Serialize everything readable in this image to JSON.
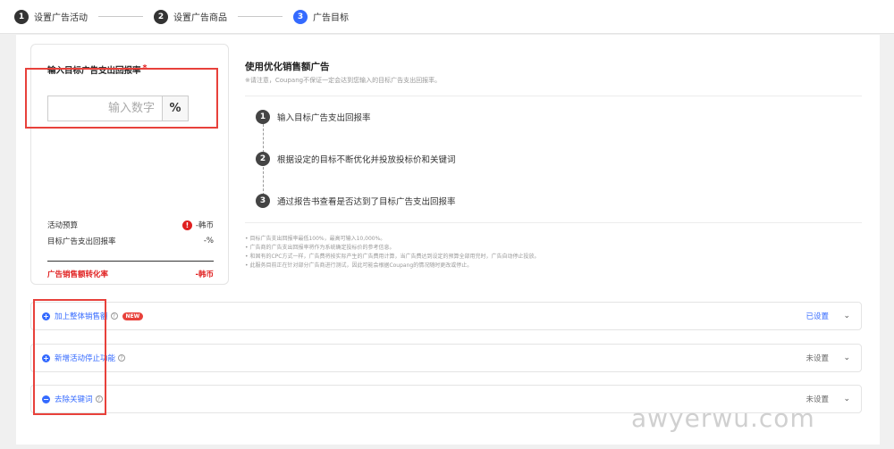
{
  "stepper": {
    "steps": [
      {
        "num": "1",
        "label": "设置广告活动"
      },
      {
        "num": "2",
        "label": "设置广告商品"
      },
      {
        "num": "3",
        "label": "广告目标"
      }
    ]
  },
  "target": {
    "title": "输入目标广告支出回报率",
    "required_mark": "*",
    "placeholder": "输入数字",
    "unit": "%"
  },
  "summary": {
    "budget_label": "活动预算",
    "budget_value": "-韩币",
    "roas_label": "目标广告支出回报率",
    "roas_value": "-%",
    "conversion_label": "广告销售额转化率",
    "conversion_value": "-韩币",
    "alert_glyph": "!"
  },
  "info": {
    "title": "使用优化销售额广告",
    "note": "※请注意，Coupang不保证一定会达到您输入的目标广告支出回报率。",
    "steps": [
      {
        "num": "1",
        "text": "输入目标广告支出回报率"
      },
      {
        "num": "2",
        "text": "根据设定的目标不断优化并投放投标价和关键词"
      },
      {
        "num": "3",
        "text": "通过报告书查看是否达到了目标广告支出回报率"
      }
    ],
    "bullets": [
      "• 目标广告支出回报率最低100%，最高可输入10,000%。",
      "• 广告商的广告支出回报率将作为系统确定投标价的参考信息。",
      "• 和固有的CPC方式一样，广告费将按实际产生的广告费用计算，当广告费达到设定的预算全部用完时，广告自动停止投放。",
      "• 此服务目前正在针对部分广告商进行测试，因此可能会根据Coupang的情况随时更改或停止。"
    ]
  },
  "options": [
    {
      "label": "加上整体销售额",
      "badge": "NEW",
      "status": "已设置",
      "icon": "plus-circle-icon"
    },
    {
      "label": "新增活动停止功能",
      "badge": "",
      "status": "未设置",
      "icon": "plus-circle-icon"
    },
    {
      "label": "去除关键词",
      "badge": "",
      "status": "未设置",
      "icon": "minus-circle-icon"
    }
  ],
  "icons": {
    "plus": "+",
    "minus": "−",
    "help": "?",
    "chevron": "⌄"
  },
  "watermark": "awyerwu.com",
  "colors": {
    "accent": "#346aff",
    "alert": "#e8413b"
  }
}
